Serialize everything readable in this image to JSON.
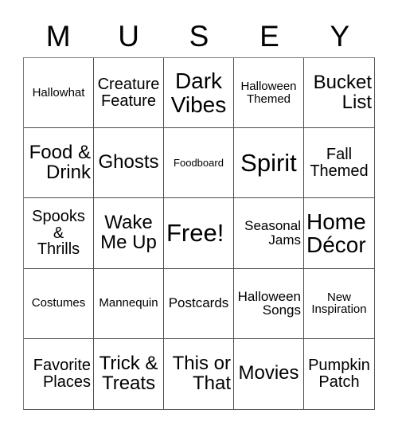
{
  "card": {
    "title_letters": [
      "M",
      "U",
      "S",
      "E",
      "Y"
    ],
    "rows": [
      [
        {
          "text": "Hallowhat",
          "size": "fs-sm",
          "align": "center"
        },
        {
          "text": "Creature\nFeature",
          "size": "fs-lg",
          "align": "center"
        },
        {
          "text": "Dark\nVibes",
          "size": "fs-xxl",
          "align": "center"
        },
        {
          "text": "Halloween\nThemed",
          "size": "fs-sm",
          "align": "center"
        },
        {
          "text": "Bucket\nList",
          "size": "fs-xl",
          "align": "right"
        }
      ],
      [
        {
          "text": "Food &\nDrink",
          "size": "fs-xl",
          "align": "right"
        },
        {
          "text": "Ghosts",
          "size": "fs-xl",
          "align": "center"
        },
        {
          "text": "Foodboard",
          "size": "fs-xs",
          "align": "center"
        },
        {
          "text": "Spirit",
          "size": "fs-huge",
          "align": "center"
        },
        {
          "text": "Fall\nThemed",
          "size": "fs-lg",
          "align": "center"
        }
      ],
      [
        {
          "text": "Spooks\n&\nThrills",
          "size": "fs-lg",
          "align": "center"
        },
        {
          "text": "Wake\nMe Up",
          "size": "fs-xl",
          "align": "center"
        },
        {
          "text": "Free!",
          "size": "fs-huge",
          "align": "left"
        },
        {
          "text": "Seasonal\nJams",
          "size": "fs-md",
          "align": "right"
        },
        {
          "text": "Home\nDécor",
          "size": "fs-xxl",
          "align": "left"
        }
      ],
      [
        {
          "text": "Costumes",
          "size": "fs-sm",
          "align": "center"
        },
        {
          "text": "Mannequin",
          "size": "fs-sm",
          "align": "center"
        },
        {
          "text": "Postcards",
          "size": "fs-md",
          "align": "center"
        },
        {
          "text": "Halloween\nSongs",
          "size": "fs-md",
          "align": "right"
        },
        {
          "text": "New\nInspiration",
          "size": "fs-sm",
          "align": "center"
        }
      ],
      [
        {
          "text": "Favorite\nPlaces",
          "size": "fs-lg",
          "align": "right"
        },
        {
          "text": "Trick &\nTreats",
          "size": "fs-xl",
          "align": "center"
        },
        {
          "text": "This or\nThat",
          "size": "fs-xl",
          "align": "right"
        },
        {
          "text": "Movies",
          "size": "fs-xl",
          "align": "center"
        },
        {
          "text": "Pumpkin\nPatch",
          "size": "fs-lg",
          "align": "center"
        }
      ]
    ]
  },
  "colors": {
    "background": "#ffffff",
    "text": "#000000",
    "grid_line": "#4d4d4d"
  }
}
